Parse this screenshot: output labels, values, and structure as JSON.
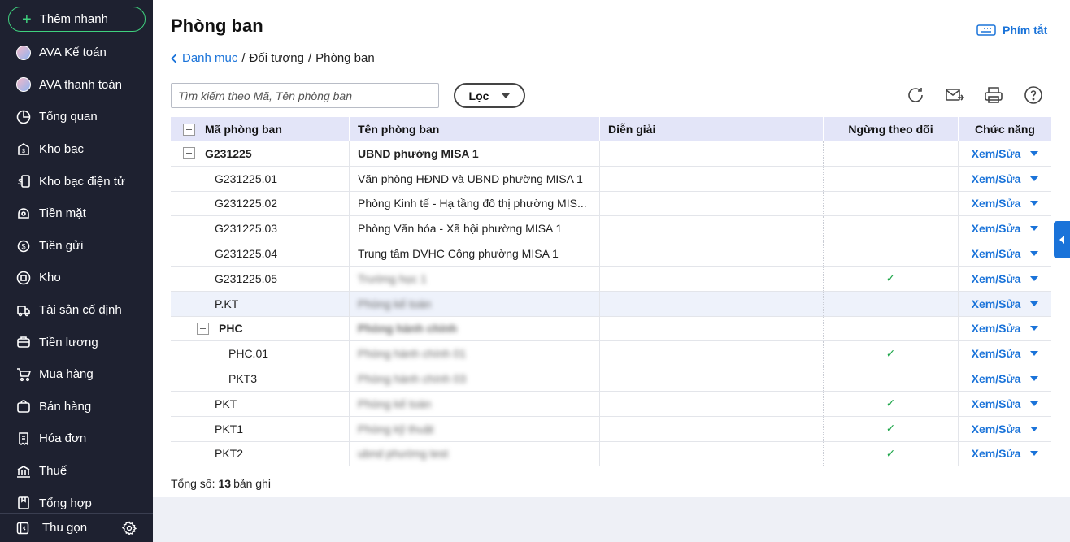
{
  "sidebar": {
    "quick_add": "Thêm nhanh",
    "items": [
      {
        "label": "AVA Kế toán",
        "icon": "ava-avatar-icon"
      },
      {
        "label": "AVA thanh toán",
        "icon": "ava-avatar-icon"
      },
      {
        "label": "Tổng quan",
        "icon": "pie-chart-icon"
      },
      {
        "label": "Kho bạc",
        "icon": "treasury-icon"
      },
      {
        "label": "Kho bạc điện tử",
        "icon": "e-treasury-icon"
      },
      {
        "label": "Tiền mặt",
        "icon": "cash-icon"
      },
      {
        "label": "Tiền gửi",
        "icon": "deposit-icon"
      },
      {
        "label": "Kho",
        "icon": "warehouse-icon"
      },
      {
        "label": "Tài sản cố định",
        "icon": "fixed-asset-icon"
      },
      {
        "label": "Tiền lương",
        "icon": "salary-icon"
      },
      {
        "label": "Mua hàng",
        "icon": "cart-icon"
      },
      {
        "label": "Bán hàng",
        "icon": "sales-icon"
      },
      {
        "label": "Hóa đơn",
        "icon": "invoice-icon"
      },
      {
        "label": "Thuế",
        "icon": "tax-icon"
      },
      {
        "label": "Tổng hợp",
        "icon": "summary-icon"
      }
    ],
    "collapse_label": "Thu gọn"
  },
  "header": {
    "title": "Phòng ban",
    "shortcut_label": "Phím tắt",
    "breadcrumb": {
      "back": "Danh mục",
      "sep1": "/",
      "level2": "Đối tượng",
      "sep2": "/",
      "current": "Phòng ban"
    }
  },
  "toolbar": {
    "search_placeholder": "Tìm kiếm theo Mã, Tên phòng ban",
    "filter_label": "Lọc"
  },
  "table": {
    "columns": [
      "Mã phòng ban",
      "Tên phòng ban",
      "Diễn giải",
      "Ngừng theo dõi",
      "Chức năng"
    ],
    "rows": [
      {
        "code": "G231225",
        "name": "UBND phường MISA 1",
        "desc": "",
        "stopped": false,
        "action": "Xem/Sửa"
      },
      {
        "code": "G231225.01",
        "name": "Văn phòng HĐND và UBND phường MISA 1",
        "desc": "",
        "stopped": false,
        "action": "Xem/Sửa"
      },
      {
        "code": "G231225.02",
        "name": "Phòng Kinh tế - Hạ tầng đô thị phường MIS...",
        "desc": "",
        "stopped": false,
        "action": "Xem/Sửa"
      },
      {
        "code": "G231225.03",
        "name": "Phòng Văn hóa - Xã hội phường MISA 1",
        "desc": "",
        "stopped": false,
        "action": "Xem/Sửa"
      },
      {
        "code": "G231225.04",
        "name": "Trung tâm DVHC Công phường MISA 1",
        "desc": "",
        "stopped": false,
        "action": "Xem/Sửa"
      },
      {
        "code": "G231225.05",
        "name": "Trường học 1",
        "desc": "",
        "stopped": true,
        "action": "Xem/Sửa"
      },
      {
        "code": "P.KT",
        "name": "Phòng kế toán",
        "desc": "",
        "stopped": false,
        "action": "Xem/Sửa"
      },
      {
        "code": "PHC",
        "name": "Phòng hành chính",
        "desc": "",
        "stopped": false,
        "action": "Xem/Sửa"
      },
      {
        "code": "PHC.01",
        "name": "Phòng hành chính 01",
        "desc": "",
        "stopped": true,
        "action": "Xem/Sửa"
      },
      {
        "code": "PKT3",
        "name": "Phòng hành chính 03",
        "desc": "",
        "stopped": false,
        "action": "Xem/Sửa"
      },
      {
        "code": "PKT",
        "name": "Phòng kế toán",
        "desc": "",
        "stopped": true,
        "action": "Xem/Sửa"
      },
      {
        "code": "PKT1",
        "name": "Phòng kỹ thuật",
        "desc": "",
        "stopped": true,
        "action": "Xem/Sửa"
      },
      {
        "code": "PKT2",
        "name": "ubnd phường test",
        "desc": "",
        "stopped": true,
        "action": "Xem/Sửa"
      }
    ]
  },
  "footer": {
    "total_label": "Tổng số:",
    "total_count": "13",
    "total_unit": "bản ghi"
  },
  "colors": {
    "accent": "#1a73d9",
    "sidebar_bg": "#1e2130",
    "header_row": "#e3e5f8",
    "check": "#1ea64a",
    "quick_add_border": "#3fd17e"
  }
}
